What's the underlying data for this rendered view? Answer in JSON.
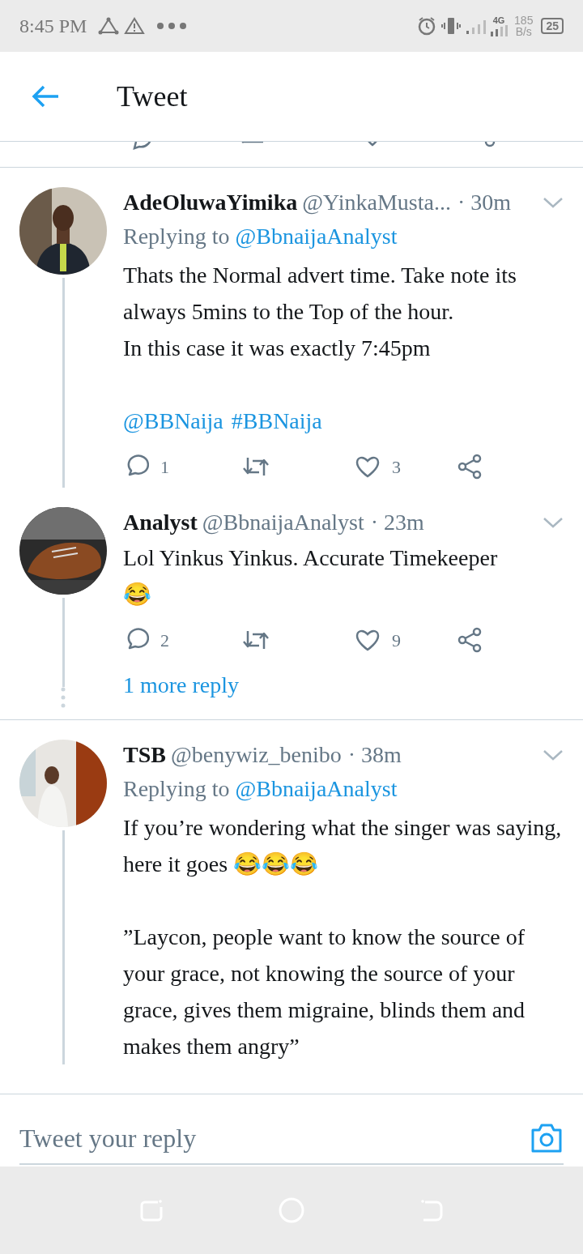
{
  "status_bar": {
    "time": "8:45 PM",
    "network": "4G",
    "speed_value": "185",
    "speed_unit": "B/s",
    "battery": "25"
  },
  "header": {
    "title": "Tweet"
  },
  "tweets": [
    {
      "name": "AdeOluwaYimika",
      "handle": "@YinkaMusta...",
      "time": "· 30m",
      "replying_label": "Replying to",
      "replying_to": "@BbnaijaAnalyst",
      "body": "Thats the Normal advert time. Take note its always 5mins to the Top of the hour.\nIn this case it was exactly 7:45pm",
      "links": [
        "@BBNaija",
        "#BBNaija"
      ],
      "replies": "1",
      "likes": "3"
    },
    {
      "name": "Analyst",
      "handle": "@BbnaijaAnalyst",
      "time": "· 23m",
      "body": "Lol Yinkus Yinkus. Accurate Timekeeper\n😂",
      "replies": "2",
      "likes": "9",
      "more_replies": "1 more reply"
    },
    {
      "name": "TSB",
      "handle": "@benywiz_benibo",
      "time": "· 38m",
      "replying_label": "Replying to",
      "replying_to": "@BbnaijaAnalyst",
      "body": "If you’re wondering what the singer was saying, here it goes 😂😂😂\n\n”Laycon, people want to know the source of your grace, not knowing the source of your grace, gives them migraine, blinds them and makes them angry”"
    }
  ],
  "reply_bar": {
    "placeholder": "Tweet your reply"
  }
}
